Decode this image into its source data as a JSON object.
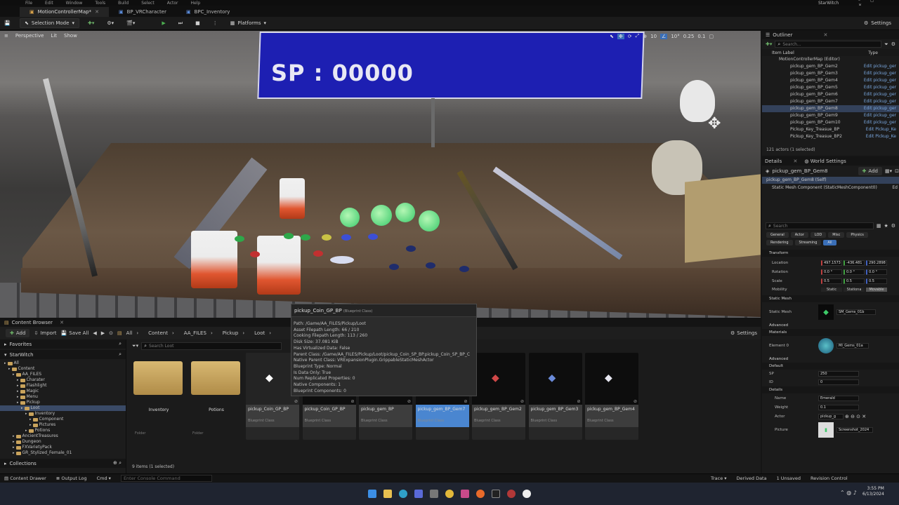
{
  "menu": [
    "File",
    "Edit",
    "Window",
    "Tools",
    "Build",
    "Select",
    "Actor",
    "Help"
  ],
  "tabs": [
    {
      "label": "MotionControllerMap*",
      "active": true
    },
    {
      "label": "BP_VRCharacter",
      "active": false
    },
    {
      "label": "BPC_Inventory",
      "active": false
    }
  ],
  "window": {
    "project": "StarWitch"
  },
  "toolbar": {
    "mode": "Selection Mode",
    "platforms": "Platforms",
    "settings": "Settings"
  },
  "viewport": {
    "perspective": "Perspective",
    "lit": "Lit",
    "show": "Show",
    "snap_angle": "10°",
    "scale_snap": "0.25",
    "camera_speed": "1",
    "grid": "10",
    "fov": "0.1",
    "sign_text": "SP : 00000"
  },
  "tooltip": {
    "title": "pickup_Coin_GP_BP",
    "subtitle": "(Blueprint Class)",
    "rows": [
      "Path: /Game/AA_FILES/Pickup/Loot",
      "Asset Filepath Length: 66 / 210",
      "Cooking Filepath Length: 113 / 260",
      "Disk Size: 37.081 KiB",
      "Has Virtualized Data: False",
      "Parent Class: /Game/AA_FILES/Pickup/Loot/pickup_Coin_SP_BP.pickup_Coin_SP_BP_C",
      "Native Parent Class: VRExpansionPlugin.GrippableStaticMeshActor",
      "Blueprint Type: Normal",
      "Is Data Only: True",
      "Num Replicated Properties: 0",
      "Native Components: 1",
      "Blueprint Components: 0"
    ]
  },
  "content_browser": {
    "tab": "Content Browser",
    "add": "Add",
    "import": "Import",
    "save_all": "Save All",
    "breadcrumb": [
      "All",
      "Content",
      "AA_FILES",
      "Pickup",
      "Loot"
    ],
    "settings": "Settings",
    "search_placeholder": "Search Loot",
    "favorites": "Favorites",
    "project": "StarWitch",
    "tree": [
      {
        "label": "All",
        "depth": 0
      },
      {
        "label": "Content",
        "depth": 1
      },
      {
        "label": "AA_FILES",
        "depth": 2
      },
      {
        "label": "Charater",
        "depth": 3
      },
      {
        "label": "Flashlight",
        "depth": 3
      },
      {
        "label": "Magic",
        "depth": 3
      },
      {
        "label": "Menu",
        "depth": 3
      },
      {
        "label": "Pickup",
        "depth": 3
      },
      {
        "label": "Loot",
        "depth": 4,
        "selected": true
      },
      {
        "label": "Inventory",
        "depth": 5
      },
      {
        "label": "Component",
        "depth": 6
      },
      {
        "label": "Pictures",
        "depth": 6
      },
      {
        "label": "Potions",
        "depth": 5
      },
      {
        "label": "AncientTreasures",
        "depth": 2
      },
      {
        "label": "Dungeon",
        "depth": 2
      },
      {
        "label": "FXVarietyPack",
        "depth": 2
      },
      {
        "label": "GR_Stylized_Female_01",
        "depth": 2
      }
    ],
    "collections": "Collections",
    "item_count": "9 items (1 selected)",
    "folders": [
      {
        "name": "Inventory",
        "cls": "Folder"
      },
      {
        "name": "Potions",
        "cls": "Folder"
      }
    ],
    "assets": [
      {
        "name": "pickup_Coin_GP_BP",
        "cls": "Blueprint Class",
        "selected": false,
        "hover": true
      },
      {
        "name": "pickup_Coin_GP_BP",
        "cls": "Blueprint Class",
        "selected": false
      },
      {
        "name": "pickup_gem_BP",
        "cls": "Blueprint Class",
        "selected": false
      },
      {
        "name": "pickup_gem_BP_Gem7",
        "cls": "Blueprint Class",
        "selected": true
      },
      {
        "name": "pickup_gem_BP_Gem2",
        "cls": "Blueprint Class",
        "selected": false
      },
      {
        "name": "pickup_gem_BP_Gem3",
        "cls": "Blueprint Class",
        "selected": false
      },
      {
        "name": "pickup_gem_BP_Gem4",
        "cls": "Blueprint Class",
        "selected": false
      }
    ]
  },
  "outliner": {
    "title": "Outliner",
    "search_placeholder": "Search...",
    "col_label": "Item Label",
    "col_type": "Type",
    "root": "MotionControllerMap (Editor)",
    "rows": [
      {
        "label": "pickup_gem_BP_Gem2",
        "type": "Edit pickup_ger"
      },
      {
        "label": "pickup_gem_BP_Gem3",
        "type": "Edit pickup_ger"
      },
      {
        "label": "pickup_gem_BP_Gem4",
        "type": "Edit pickup_ger"
      },
      {
        "label": "pickup_gem_BP_Gem5",
        "type": "Edit pickup_ger"
      },
      {
        "label": "pickup_gem_BP_Gem6",
        "type": "Edit pickup_ger"
      },
      {
        "label": "pickup_gem_BP_Gem7",
        "type": "Edit pickup_ger"
      },
      {
        "label": "pickup_gem_BP_Gem8",
        "type": "Edit pickup_ger",
        "selected": true
      },
      {
        "label": "pickup_gem_BP_Gem9",
        "type": "Edit pickup_ger"
      },
      {
        "label": "pickup_gem_BP_Gem10",
        "type": "Edit pickup_ger"
      },
      {
        "label": "Pickup_Key_Treasue_BP",
        "type": "Edit Pickup_Ke"
      },
      {
        "label": "Pickup_Key_Treasue_BP2",
        "type": "Edit Pickup_Ke"
      }
    ],
    "footer": "121 actors (1 selected)"
  },
  "details": {
    "tab": "Details",
    "tab2": "World Settings",
    "actor": "pickup_gem_BP_Gem8",
    "add": "Add",
    "self": "pickup_gem_BP_Gem8 (Self)",
    "component": "Static Mesh Component (StaticMeshComponent0)",
    "component_edit": "Ed",
    "search_placeholder": "Search",
    "filters": [
      "General",
      "Actor",
      "LOD",
      "Misc",
      "Physics",
      "Rendering",
      "Streaming",
      "All"
    ],
    "transform": "Transform",
    "location_label": "Location",
    "location": [
      "497.1573",
      "-436.481",
      "290.2898"
    ],
    "rotation_label": "Rotation",
    "rotation": [
      "0.0 °",
      "0.0 °",
      "0.0 °"
    ],
    "scale_label": "Scale",
    "scale": [
      "0.5",
      "0.5",
      "0.5"
    ],
    "mobility_label": "Mobility",
    "mobility": [
      "Static",
      "Stationa",
      "Movable"
    ],
    "static_mesh_section": "Static Mesh",
    "static_mesh_label": "Static Mesh",
    "static_mesh": "SM_Gems_01b",
    "advanced": "Advanced",
    "materials": "Materials",
    "element0": "Element 0",
    "material": "MI_Gems_01a",
    "default_section": "Default",
    "sp_label": "SP",
    "sp": "250",
    "id_label": "ID",
    "id": "0",
    "details_section": "Details",
    "name_label": "Name",
    "name": "Emerald",
    "weight_label": "Weight",
    "weight": "0.1",
    "actor_label": "Actor",
    "actor_val": "pickup_g",
    "picture_label": "Picture",
    "picture": "Screenshot_2024"
  },
  "status": {
    "content_drawer": "Content Drawer",
    "output_log": "Output Log",
    "cmd": "Cmd",
    "console_placeholder": "Enter Console Command",
    "trace": "Trace",
    "derived": "Derived Data",
    "unsaved": "1 Unsaved",
    "revision": "Revision Control"
  },
  "taskbar": {
    "time": "3:55 PM",
    "date": "6/13/2024"
  }
}
